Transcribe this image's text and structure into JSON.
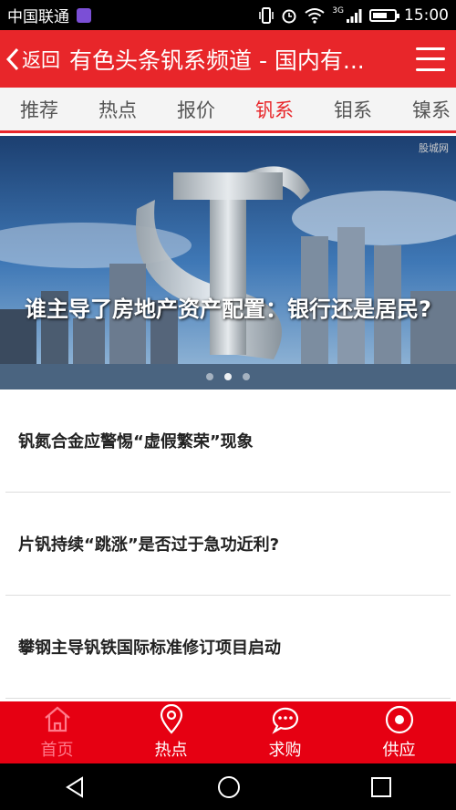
{
  "status_bar": {
    "carrier": "中国联通",
    "time": "15:00",
    "network": "3G",
    "battery_level": 0.7
  },
  "header": {
    "back_label": "返回",
    "title": "有色头条钒系频道 - 国内有..."
  },
  "tabs": [
    {
      "label": "推荐",
      "active": false
    },
    {
      "label": "热点",
      "active": false
    },
    {
      "label": "报价",
      "active": false
    },
    {
      "label": "钒系",
      "active": true
    },
    {
      "label": "钼系",
      "active": false
    },
    {
      "label": "镍系",
      "active": false
    }
  ],
  "banner": {
    "caption": "谁主导了房地产资产配置：银行还是居民?",
    "watermark": "股城网",
    "slide_count": 3,
    "active_slide": 1
  },
  "news": [
    {
      "title": "钒氮合金应警惕“虚假繁荣”现象"
    },
    {
      "title": "片钒持续“跳涨”是否过于急功近利?"
    },
    {
      "title": "攀钢主导钒铁国际标准修订项目启动"
    }
  ],
  "bottom_nav": [
    {
      "label": "首页",
      "icon": "home-icon",
      "active": true
    },
    {
      "label": "热点",
      "icon": "location-pin-icon",
      "active": false
    },
    {
      "label": "求购",
      "icon": "chat-bubble-icon",
      "active": false
    },
    {
      "label": "供应",
      "icon": "target-circle-icon",
      "active": false
    }
  ],
  "colors": {
    "primary_red": "#e8262a",
    "nav_red": "#e60012",
    "active_pink": "#ff7a8a"
  }
}
